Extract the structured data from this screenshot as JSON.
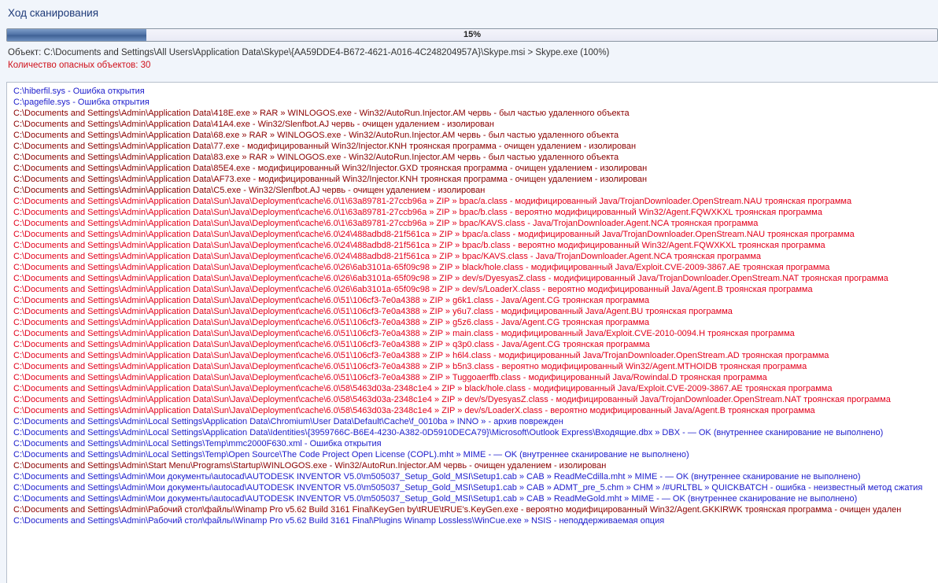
{
  "title": "Ход сканирования",
  "progress": {
    "percent": 15,
    "label": "15%"
  },
  "object_line": "Объект: C:\\Documents and Settings\\All Users\\Application Data\\Skype\\{AA59DDE4-B672-4621-A016-4C248204957A}\\Skype.msi > Skype.exe (100%)",
  "threat_count": "Количество опасных объектов: 30",
  "colors": {
    "info": "#1c1ccc",
    "cleaned": "#8b0000",
    "threat": "#e3001b"
  },
  "log": [
    {
      "t": "b",
      "text": "C:\\hiberfil.sys - Ошибка открытия"
    },
    {
      "t": "b",
      "text": "C:\\pagefile.sys - Ошибка открытия"
    },
    {
      "t": "d",
      "text": "C:\\Documents and Settings\\Admin\\Application Data\\418E.exe » RAR » WINLOGOS.exe - Win32/AutoRun.Injector.AM червь - был частью удаленного объекта"
    },
    {
      "t": "d",
      "text": "C:\\Documents and Settings\\Admin\\Application Data\\41A4.exe - Win32/Slenfbot.AJ червь - очищен удалением - изолирован"
    },
    {
      "t": "d",
      "text": "C:\\Documents and Settings\\Admin\\Application Data\\68.exe » RAR » WINLOGOS.exe - Win32/AutoRun.Injector.AM червь - был частью удаленного объекта"
    },
    {
      "t": "d",
      "text": "C:\\Documents and Settings\\Admin\\Application Data\\77.exe - модифицированный Win32/Injector.KNH троянская программа - очищен удалением - изолирован"
    },
    {
      "t": "d",
      "text": "C:\\Documents and Settings\\Admin\\Application Data\\83.exe » RAR » WINLOGOS.exe - Win32/AutoRun.Injector.AM червь - был частью удаленного объекта"
    },
    {
      "t": "d",
      "text": "C:\\Documents and Settings\\Admin\\Application Data\\85E4.exe - модифицированный Win32/Injector.GXD троянская программа - очищен удалением - изолирован"
    },
    {
      "t": "d",
      "text": "C:\\Documents and Settings\\Admin\\Application Data\\AF73.exe - модифицированный Win32/Injector.KNH троянская программа - очищен удалением - изолирован"
    },
    {
      "t": "d",
      "text": "C:\\Documents and Settings\\Admin\\Application Data\\C5.exe - Win32/Slenfbot.AJ червь - очищен удалением - изолирован"
    },
    {
      "t": "r",
      "text": "C:\\Documents and Settings\\Admin\\Application Data\\Sun\\Java\\Deployment\\cache\\6.0\\1\\63a89781-27ccb96a » ZIP » bpac/a.class - модифицированный Java/TrojanDownloader.OpenStream.NAU троянская программа"
    },
    {
      "t": "r",
      "text": "C:\\Documents and Settings\\Admin\\Application Data\\Sun\\Java\\Deployment\\cache\\6.0\\1\\63a89781-27ccb96a » ZIP » bpac/b.class - вероятно модифицированный  Win32/Agent.FQWXKXL  троянская программа"
    },
    {
      "t": "r",
      "text": "C:\\Documents and Settings\\Admin\\Application Data\\Sun\\Java\\Deployment\\cache\\6.0\\1\\63a89781-27ccb96a » ZIP » bpac/KAVS.class - Java/TrojanDownloader.Agent.NCA троянская программа"
    },
    {
      "t": "r",
      "text": "C:\\Documents and Settings\\Admin\\Application Data\\Sun\\Java\\Deployment\\cache\\6.0\\24\\488adbd8-21f561ca » ZIP » bpac/a.class - модифицированный Java/TrojanDownloader.OpenStream.NAU троянская программа"
    },
    {
      "t": "r",
      "text": "C:\\Documents and Settings\\Admin\\Application Data\\Sun\\Java\\Deployment\\cache\\6.0\\24\\488adbd8-21f561ca » ZIP » bpac/b.class - вероятно модифицированный  Win32/Agent.FQWXKXL  троянская программа"
    },
    {
      "t": "r",
      "text": "C:\\Documents and Settings\\Admin\\Application Data\\Sun\\Java\\Deployment\\cache\\6.0\\24\\488adbd8-21f561ca » ZIP » bpac/KAVS.class - Java/TrojanDownloader.Agent.NCA троянская программа"
    },
    {
      "t": "r",
      "text": "C:\\Documents and Settings\\Admin\\Application Data\\Sun\\Java\\Deployment\\cache\\6.0\\26\\6ab3101a-65f09c98 » ZIP » black/hole.class - модифицированный Java/Exploit.CVE-2009-3867.AE троянская программа"
    },
    {
      "t": "r",
      "text": "C:\\Documents and Settings\\Admin\\Application Data\\Sun\\Java\\Deployment\\cache\\6.0\\26\\6ab3101a-65f09c98 » ZIP » dev/s/DyesyasZ.class - модифицированный Java/TrojanDownloader.OpenStream.NAT троянская программа"
    },
    {
      "t": "r",
      "text": "C:\\Documents and Settings\\Admin\\Application Data\\Sun\\Java\\Deployment\\cache\\6.0\\26\\6ab3101a-65f09c98 » ZIP » dev/s/LoaderX.class - вероятно модифицированный  Java/Agent.B  троянская программа"
    },
    {
      "t": "r",
      "text": "C:\\Documents and Settings\\Admin\\Application Data\\Sun\\Java\\Deployment\\cache\\6.0\\51\\106cf3-7e0a4388 » ZIP » g6k1.class - Java/Agent.CG троянская программа"
    },
    {
      "t": "r",
      "text": "C:\\Documents and Settings\\Admin\\Application Data\\Sun\\Java\\Deployment\\cache\\6.0\\51\\106cf3-7e0a4388 » ZIP » y6u7.class - модифицированный Java/Agent.BU троянская программа"
    },
    {
      "t": "r",
      "text": "C:\\Documents and Settings\\Admin\\Application Data\\Sun\\Java\\Deployment\\cache\\6.0\\51\\106cf3-7e0a4388 » ZIP » g5z6.class - Java/Agent.CG троянская программа"
    },
    {
      "t": "r",
      "text": "C:\\Documents and Settings\\Admin\\Application Data\\Sun\\Java\\Deployment\\cache\\6.0\\51\\106cf3-7e0a4388 » ZIP » main.class - модифицированный Java/Exploit.CVE-2010-0094.H троянская программа"
    },
    {
      "t": "r",
      "text": "C:\\Documents and Settings\\Admin\\Application Data\\Sun\\Java\\Deployment\\cache\\6.0\\51\\106cf3-7e0a4388 » ZIP » q3p0.class - Java/Agent.CG троянская программа"
    },
    {
      "t": "r",
      "text": "C:\\Documents and Settings\\Admin\\Application Data\\Sun\\Java\\Deployment\\cache\\6.0\\51\\106cf3-7e0a4388 » ZIP » h6l4.class - модифицированный Java/TrojanDownloader.OpenStream.AD троянская программа"
    },
    {
      "t": "r",
      "text": "C:\\Documents and Settings\\Admin\\Application Data\\Sun\\Java\\Deployment\\cache\\6.0\\51\\106cf3-7e0a4388 » ZIP » b5n3.class - вероятно модифицированный  Win32/Agent.MTHOIDB  троянская программа"
    },
    {
      "t": "r",
      "text": "C:\\Documents and Settings\\Admin\\Application Data\\Sun\\Java\\Deployment\\cache\\6.0\\51\\106cf3-7e0a4388 » ZIP » Tuggoaerffb.class - модифицированный Java/Rowindal.D троянская программа"
    },
    {
      "t": "r",
      "text": "C:\\Documents and Settings\\Admin\\Application Data\\Sun\\Java\\Deployment\\cache\\6.0\\58\\5463d03a-2348c1e4 » ZIP » black/hole.class - модифицированный Java/Exploit.CVE-2009-3867.AE троянская программа"
    },
    {
      "t": "r",
      "text": "C:\\Documents and Settings\\Admin\\Application Data\\Sun\\Java\\Deployment\\cache\\6.0\\58\\5463d03a-2348c1e4 » ZIP » dev/s/DyesyasZ.class - модифицированный Java/TrojanDownloader.OpenStream.NAT троянская программа"
    },
    {
      "t": "r",
      "text": "C:\\Documents and Settings\\Admin\\Application Data\\Sun\\Java\\Deployment\\cache\\6.0\\58\\5463d03a-2348c1e4 » ZIP » dev/s/LoaderX.class - вероятно модифицированный  Java/Agent.B  троянская программа"
    },
    {
      "t": "b",
      "text": "C:\\Documents and Settings\\Admin\\Local Settings\\Application Data\\Chromium\\User Data\\Default\\Cache\\f_0010ba » INNO »  - архив поврежден"
    },
    {
      "t": "b",
      "text": "C:\\Documents and Settings\\Admin\\Local Settings\\Application Data\\Identities\\{3959766C-B6E4-4230-A382-0D5910DECA79}\\Microsoft\\Outlook Express\\Входящие.dbx » DBX - — OK (внутреннее сканирование не выполнено)"
    },
    {
      "t": "b",
      "text": "C:\\Documents and Settings\\Admin\\Local Settings\\Temp\\mmc2000F630.xml - Ошибка открытия"
    },
    {
      "t": "b",
      "text": "C:\\Documents and Settings\\Admin\\Local Settings\\Temp\\Open Source\\The Code Project Open License (COPL).mht » MIME - — OK (внутреннее сканирование не выполнено)"
    },
    {
      "t": "d",
      "text": "C:\\Documents and Settings\\Admin\\Start Menu\\Programs\\Startup\\WINLOGOS.exe - Win32/AutoRun.Injector.AM червь - очищен удалением - изолирован"
    },
    {
      "t": "b",
      "text": "C:\\Documents and Settings\\Admin\\Мои документы\\autocad\\AUTODESK INVENTOR V5.0\\m505037_Setup_Gold_MSI\\Setup1.cab » CAB » ReadMeCdilla.mht » MIME - — OK (внутреннее сканирование не выполнено)"
    },
    {
      "t": "b",
      "text": "C:\\Documents and Settings\\Admin\\Мои документы\\autocad\\AUTODESK INVENTOR V5.0\\m505037_Setup_Gold_MSI\\Setup1.cab » CAB » ADMT_pre_5.chm » CHM » /#URLTBL » QUICKBATCH - ошибка - неизвестный метод сжатия"
    },
    {
      "t": "b",
      "text": "C:\\Documents and Settings\\Admin\\Мои документы\\autocad\\AUTODESK INVENTOR V5.0\\m505037_Setup_Gold_MSI\\Setup1.cab » CAB » ReadMeGold.mht » MIME - — OK (внутреннее сканирование не выполнено)"
    },
    {
      "t": "d",
      "text": "C:\\Documents and Settings\\Admin\\Рабочий стол\\файлы\\Winamp Pro v5.62 Build 3161 Final\\KeyGen by\\tRUE\\tRUE's.KeyGen.exe - вероятно модифицированный  Win32/Agent.GKKIRWK  троянская программа - очищен удален"
    },
    {
      "t": "b",
      "text": "C:\\Documents and Settings\\Admin\\Рабочий стол\\файлы\\Winamp Pro v5.62 Build 3161 Final\\Plugins Winamp  Lossless\\WinCue.exe » NSIS - неподдерживаемая опция"
    }
  ]
}
